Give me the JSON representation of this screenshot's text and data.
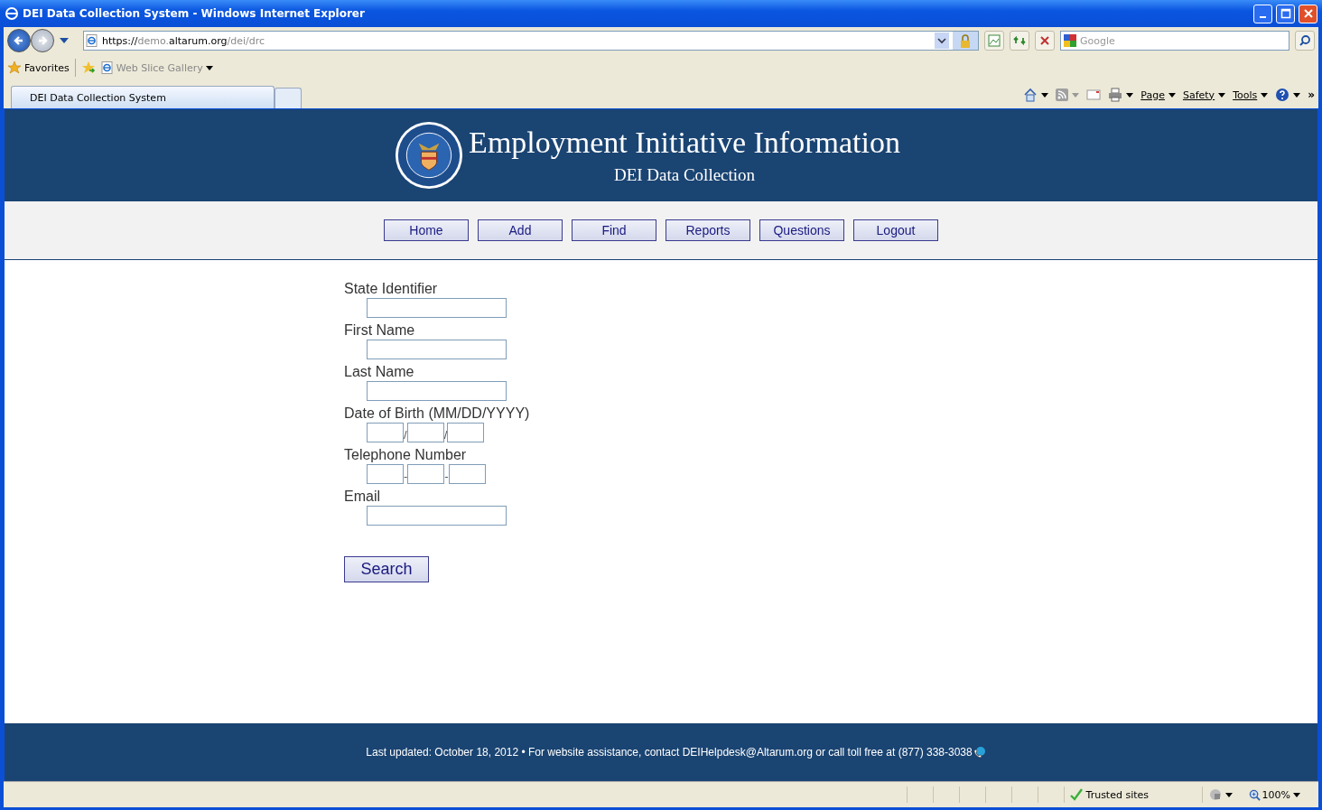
{
  "window": {
    "title": "DEI Data Collection System - Windows Internet Explorer"
  },
  "address_bar": {
    "scheme": "https://",
    "subdomain": "demo.",
    "domain": "altarum.org",
    "path": "/dei/drc"
  },
  "search_box": {
    "placeholder": "Google"
  },
  "favorites_bar": {
    "favorites": "Favorites",
    "gallery": "Web Slice Gallery"
  },
  "tabs": [
    {
      "label": "DEI Data Collection System",
      "selected": true
    }
  ],
  "command_bar": {
    "menus": [
      "Page",
      "Safety",
      "Tools"
    ],
    "overflow": "»"
  },
  "header": {
    "title": "Employment Initiative Information",
    "subtitle": "DEI Data Collection"
  },
  "nav": [
    {
      "label": "Home"
    },
    {
      "label": "Add"
    },
    {
      "label": "Find"
    },
    {
      "label": "Reports"
    },
    {
      "label": "Questions"
    },
    {
      "label": "Logout"
    }
  ],
  "form": {
    "fields": [
      {
        "label": "State Identifier",
        "kind": "text"
      },
      {
        "label": "First Name",
        "kind": "text"
      },
      {
        "label": "Last Name",
        "kind": "text"
      },
      {
        "label": "Date of Birth (MM/DD/YYYY)",
        "kind": "split",
        "separator": "/"
      },
      {
        "label": "Telephone Number",
        "kind": "split",
        "separator": "-"
      },
      {
        "label": "Email",
        "kind": "text"
      }
    ],
    "submit": "Search"
  },
  "footer": {
    "text": "Last updated: October 18, 2012 • For website assistance, contact DEIHelpdesk@Altarum.org or call toll free at (877) 338-3038"
  },
  "status_bar": {
    "zone": "Trusted sites",
    "zoom": "100%"
  }
}
